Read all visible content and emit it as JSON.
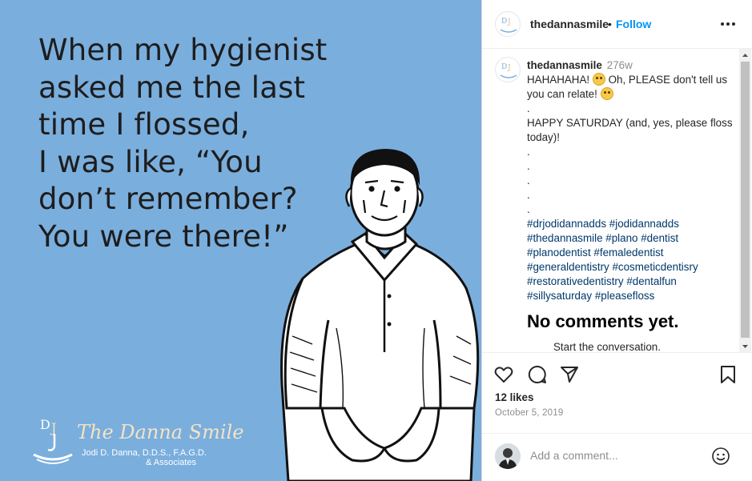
{
  "image": {
    "meme_text": "When my hygienist\nasked me the last\ntime I flossed,\nI was like, “You\ndon’t remember?\nYou were there!”",
    "logo": {
      "mark": "DJ",
      "name": "The Danna Smile",
      "sub_line_1": "Jodi D. Danna, D.D.S., F.A.G.D.",
      "sub_line_2": "& Associates"
    },
    "background_color": "#7aaedd"
  },
  "header": {
    "username": "thedannasmile",
    "separator": "•",
    "follow_label": "Follow",
    "avatar_text": "DJ"
  },
  "caption": {
    "username": "thedannasmile",
    "time": "276w",
    "line_1a": "HAHAHAHA!",
    "line_1b": "Oh, PLEASE don't tell us you can relate!",
    "dot": ".",
    "line_2": "HAPPY SATURDAY (and, yes, please floss today)!",
    "dots": [
      ".",
      ".",
      ".",
      ".",
      "."
    ],
    "hashtags": [
      "#drjodidannadds",
      "#jodidannadds",
      "#thedannasmile",
      "#plano",
      "#dentist",
      "#planodentist",
      "#femaledentist",
      "#generaldentistry",
      "#cosmeticdentisry",
      "#restorativedentistry",
      "#dentalfun",
      "#sillysaturday",
      "#pleasefloss"
    ]
  },
  "empty_state": {
    "title": "No comments yet.",
    "subtitle": "Start the conversation."
  },
  "actions": {
    "likes": "12 likes",
    "date": "October 5, 2019",
    "comment_placeholder": "Add a comment..."
  },
  "colors": {
    "link": "#0095f6",
    "hashtag": "#00376b",
    "muted": "#8e8e8e"
  }
}
